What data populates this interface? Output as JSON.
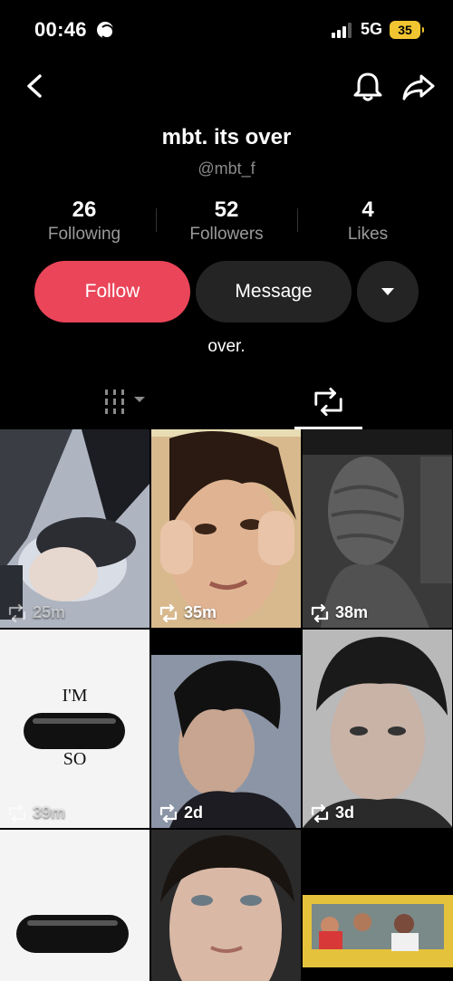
{
  "status_bar": {
    "time": "00:46",
    "network": "5G",
    "battery": "35"
  },
  "profile": {
    "name": "mbt. its over",
    "handle": "@mbt_f",
    "bio": "over."
  },
  "stats": [
    {
      "value": "26",
      "label": "Following"
    },
    {
      "value": "52",
      "label": "Followers"
    },
    {
      "value": "4",
      "label": "Likes"
    }
  ],
  "actions": {
    "follow": "Follow",
    "message": "Message"
  },
  "tabs": {
    "active": "reposts"
  },
  "grid": [
    {
      "label": "25m",
      "theme": "photo-car"
    },
    {
      "label": "35m",
      "theme": "photo-face-warm"
    },
    {
      "label": "38m",
      "theme": "photo-wrapped-head"
    },
    {
      "label": "39m",
      "theme": "pill-im-so"
    },
    {
      "label": "2d",
      "theme": "photo-curly-hair"
    },
    {
      "label": "3d",
      "theme": "photo-portrait-bw"
    },
    {
      "label": "",
      "theme": "pill"
    },
    {
      "label": "",
      "theme": "photo-woman-face"
    },
    {
      "label": "",
      "theme": "photo-taxi"
    }
  ],
  "pill_text": {
    "top": "I'M",
    "bottom": "SO"
  },
  "colors": {
    "accent": "#ea4559",
    "button_dark": "#242424",
    "battery": "#f0c531"
  }
}
